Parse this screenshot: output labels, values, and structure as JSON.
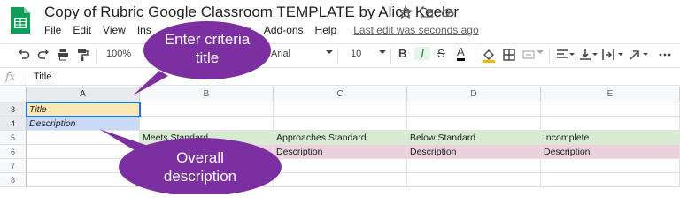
{
  "header": {
    "doc_title": "Copy of Rubric Google Classroom TEMPLATE by Alice Keeler",
    "icons": [
      "star-icon",
      "move-to-folder-icon",
      "cloud-status-icon"
    ]
  },
  "menubar": {
    "items": [
      "File",
      "Edit",
      "View",
      "Ins",
      "s",
      "Add-ons",
      "Help"
    ],
    "last_edit": "Last edit was seconds ago"
  },
  "toolbar": {
    "zoom": "100%",
    "font": "Arial",
    "font_size": "10",
    "bold": "B",
    "italic": "I",
    "strike": "S",
    "text_color": "A"
  },
  "formula_bar": {
    "fx": "fx",
    "value": "Title"
  },
  "grid": {
    "columns": [
      "A",
      "B",
      "C",
      "D",
      "E"
    ],
    "rows": [
      "3",
      "4",
      "5",
      "6",
      "7",
      "8"
    ],
    "cells": {
      "A3": "Title",
      "A4": "Description",
      "B5": "Meets Standard",
      "C5": "Approaches Standard",
      "D5": "Below Standard",
      "E5": "Incomplete",
      "B6": "",
      "C6": "Description",
      "D6": "Description",
      "E6": "Description"
    }
  },
  "callouts": {
    "top": [
      "Enter criteria",
      "title"
    ],
    "bottom": [
      "Overall",
      "description"
    ]
  },
  "colors": {
    "callout": "#7b2fa1",
    "yellow_fill": "#fce8b2",
    "blue_fill": "#c9daf8",
    "green_fill": "#d9ead3",
    "pink_fill": "#ead1dc",
    "sheets_green": "#0f9d58"
  }
}
